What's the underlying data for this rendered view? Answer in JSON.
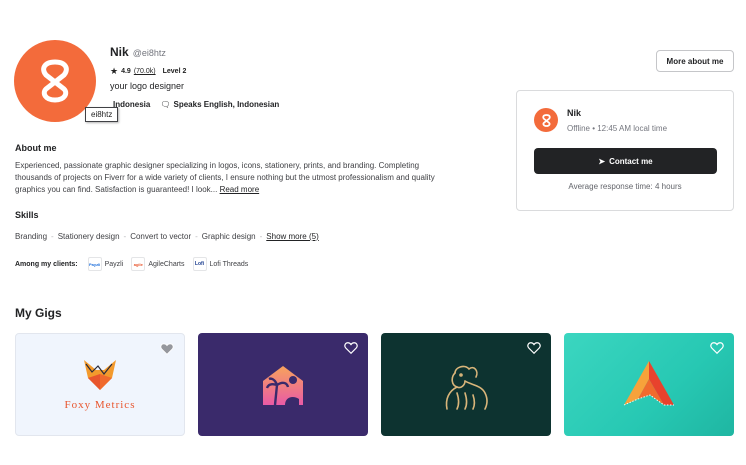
{
  "profile": {
    "name": "Nik",
    "handle": "@ei8htz",
    "rating": "4.9",
    "reviews": "(70.0k)",
    "level": "Level 2",
    "tagline": "your logo designer",
    "country": "Indonesia",
    "languages": "Speaks English, Indonesian",
    "tooltip": "ei8htz",
    "avatar_color": "#f36b3b"
  },
  "header": {
    "more_about_me": "More about me"
  },
  "contact_card": {
    "name": "Nik",
    "status": "Offline • 12:45 AM local time",
    "contact_label": "Contact me",
    "response": "Average response time: 4 hours"
  },
  "about": {
    "title": "About me",
    "text": "Experienced, passionate graphic designer specializing in logos, icons, stationery, prints, and branding. Completing thousands of projects on Fiverr for a wide variety of clients, I ensure nothing but the utmost professionalism and quality graphics you can find. Satisfaction is guaranteed! I look...",
    "read_more": "Read more"
  },
  "skills": {
    "title": "Skills",
    "items": [
      "Branding",
      "Stationery design",
      "Convert to vector",
      "Graphic design"
    ],
    "show_more": "Show more (5)"
  },
  "clients": {
    "label": "Among my clients:",
    "items": [
      {
        "name": "Payzli",
        "logo": "Payzli"
      },
      {
        "name": "AgileCharts",
        "logo": "agile"
      },
      {
        "name": "Lofi Threads",
        "logo": "Lofi"
      }
    ]
  },
  "gigs": {
    "title": "My Gigs",
    "items": [
      {
        "caption": "Foxy Metrics",
        "icon": "fox-logo-icon"
      },
      {
        "caption": "",
        "icon": "house-palm-logo-icon"
      },
      {
        "caption": "",
        "icon": "gorilla-logo-icon"
      },
      {
        "caption": "",
        "icon": "triangle-a-logo-icon"
      }
    ]
  }
}
